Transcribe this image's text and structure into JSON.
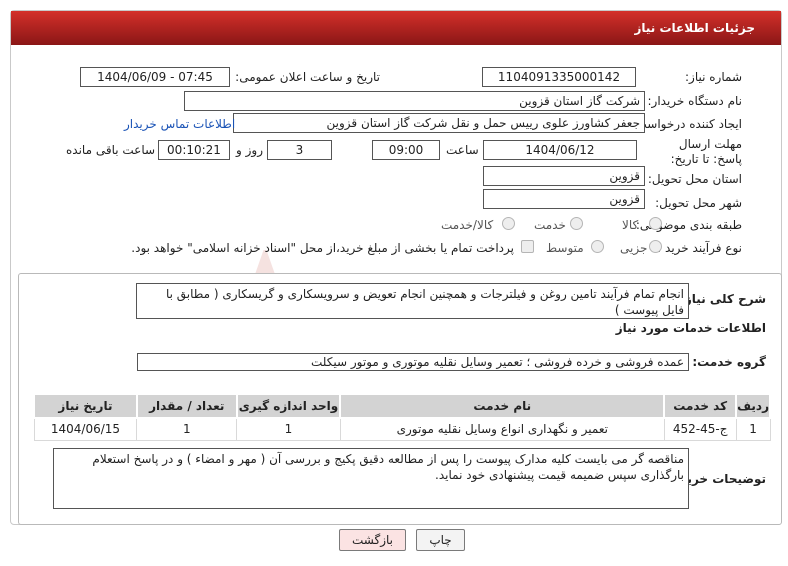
{
  "header": {
    "title": "جزئیات اطلاعات نیاز"
  },
  "form": {
    "need_number_label": "شماره نیاز:",
    "need_number": "1104091335000142",
    "announce_label": "تاریخ و ساعت اعلان عمومی:",
    "announce_value": "1404/06/09 - 07:45",
    "buyer_label": "نام دستگاه خریدار:",
    "buyer_value": "شرکت گاز استان قزوین",
    "creator_label": "ایجاد کننده درخواست:",
    "creator_value": "جعفر کشاورز علوی رییس حمل و نقل شرکت گاز استان قزوین",
    "contact_link": "اطلاعات تماس خریدار",
    "deadline_label": "مهلت ارسال پاسخ: تا تاریخ:",
    "deadline_date": "1404/06/12",
    "time_label": "ساعت",
    "deadline_time": "09:00",
    "days_value": "3",
    "days_label": "روز و",
    "remaining_value": "00:10:21",
    "remaining_label": "ساعت باقی مانده",
    "province_label": "استان محل تحویل:",
    "province_value": "قزوین",
    "city_label": "شهر محل تحویل:",
    "city_value": "قزوین",
    "category_label": "طبقه بندی موضوعی:",
    "category_options": [
      "کالا",
      "خدمت",
      "کالا/خدمت"
    ],
    "process_label": "نوع فرآیند خرید :",
    "process_options": [
      "جزیی",
      "متوسط"
    ],
    "payment_note": "پرداخت تمام یا بخشی از مبلغ خرید،از محل \"اسناد خزانه اسلامی\" خواهد بود."
  },
  "details": {
    "summary_label": "شرح کلی نیاز:",
    "summary_value": "انجام تمام فرآیند تامین روغن و فیلترجات و همچنین انجام تعویض و سرویسکاری و گریسکاری ( مطابق با فایل پیوست )",
    "services_title": "اطلاعات خدمات مورد نیاز",
    "group_label": "گروه خدمت:",
    "group_value": "عمده فروشی و خرده فروشی ؛ تعمیر وسایل نقلیه موتوری و موتور سیکلت",
    "table": {
      "headers": [
        "ردیف",
        "کد خدمت",
        "نام خدمت",
        "واحد اندازه گیری",
        "تعداد / مقدار",
        "تاریخ نیاز"
      ],
      "rows": [
        [
          "1",
          "ج-45-452",
          "تعمیر و نگهداری انواع وسایل نقلیه موتوری",
          "1",
          "1",
          "1404/06/15"
        ]
      ]
    },
    "buyer_notes_label": "توضیحات خریدار:",
    "buyer_notes_value": "مناقصه گر می بایست کلیه مدارک پیوست را پس از مطالعه دقیق پکیج و بررسی آن ( مهر و امضاء ) و در پاسخ استعلام بارگذاری سپس ضمیمه قیمت پیشنهادی خود نماید."
  },
  "buttons": {
    "print": "چاپ",
    "back": "بازگشت"
  },
  "colors": {
    "header_red": "#b8231f",
    "link_blue": "#1a53b6",
    "back_button_bg": "#fbe3e3"
  }
}
